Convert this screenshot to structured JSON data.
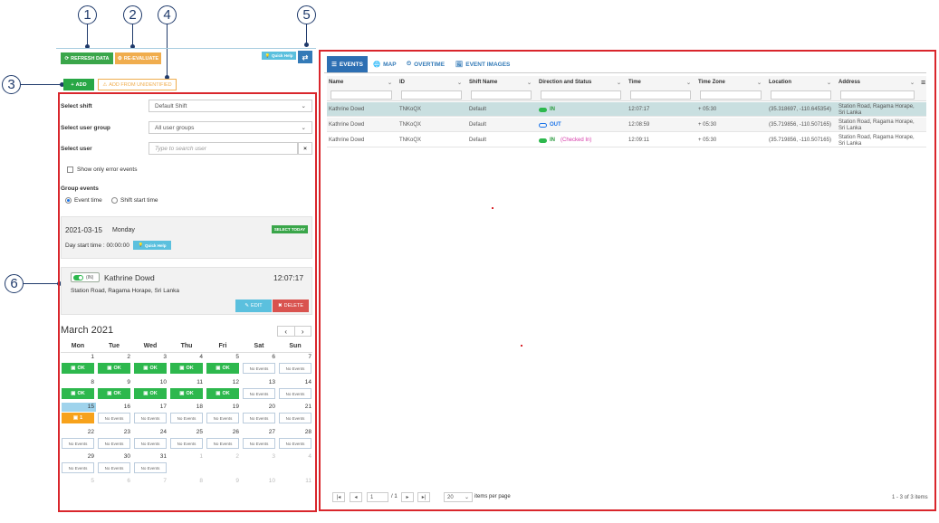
{
  "callouts": [
    "1",
    "2",
    "3",
    "4",
    "5",
    "6"
  ],
  "toolbar": {
    "refresh": "REFRESH DATA",
    "reevaluate": "RE-EVALUATE",
    "add": "ADD",
    "add_unidentified": "ADD FROM UNIDENTIFIED",
    "quick_help": "Quick Help"
  },
  "filters": {
    "shift_label": "Select shift",
    "shift_value": "Default Shift",
    "group_label": "Select user group",
    "group_value": "All user groups",
    "user_label": "Select user",
    "user_placeholder": "Type to search user",
    "error_events": "Show only error events",
    "group_events": "Group events",
    "event_time": "Event time",
    "shift_start": "Shift start time"
  },
  "day": {
    "date": "2021-03-15",
    "weekday": "Monday",
    "select_today": "SELECT TODAY",
    "start_time": "Day start time : 00:00:00",
    "quick_help": "Quick Help"
  },
  "event_card": {
    "status": "(IN)",
    "name": "Kathrine Dowd",
    "time": "12:07:17",
    "address": "Station Road, Ragama Horape, Sri Lanka",
    "edit": "EDIT",
    "delete": "DELETE"
  },
  "calendar": {
    "title": "March 2021",
    "weekdays": [
      "Mon",
      "Tue",
      "Wed",
      "Thu",
      "Fri",
      "Sat",
      "Sun"
    ],
    "ok_label": "OK",
    "no_events": "No Events",
    "warn_label": "1"
  },
  "tabs": {
    "events": "EVENTS",
    "map": "MAP",
    "overtime": "OVERTIME",
    "images": "EVENT IMAGES"
  },
  "table": {
    "headers": [
      "Name",
      "ID",
      "Shift Name",
      "Direction and Status",
      "Time",
      "Time Zone",
      "Location",
      "Address"
    ],
    "rows": [
      {
        "name": "Kathrine Dowd",
        "id": "TNKoQX",
        "shift": "Default",
        "dir": "IN",
        "extra": "",
        "time": "12:07:17",
        "tz": "+ 05:30",
        "loc": "(35.318697, -110.645354)",
        "addr": "Station Road, Ragama Horape, Sri Lanka"
      },
      {
        "name": "Kathrine Dowd",
        "id": "TNKoQX",
        "shift": "Default",
        "dir": "OUT",
        "extra": "",
        "time": "12:08:59",
        "tz": "+ 05:30",
        "loc": "(35.719856, -110.507165)",
        "addr": "Station Road, Ragama Horape, Sri Lanka"
      },
      {
        "name": "Kathrine Dowd",
        "id": "TNKoQX",
        "shift": "Default",
        "dir": "IN",
        "extra": "(Checked In)",
        "time": "12:09:11",
        "tz": "+ 05:30",
        "loc": "(35.719856, -110.507165)",
        "addr": "Station Road, Ragama Horape, Sri Lanka"
      }
    ]
  },
  "pager": {
    "page": "1",
    "of": "/ 1",
    "per_page": "20",
    "items_label": "items per page",
    "summary": "1 - 3 of 3 items"
  },
  "colors": {
    "annotation": "#d9262c",
    "ok_green": "#2db84d",
    "warn_orange": "#f7a21b",
    "accent_blue": "#337ab7"
  }
}
